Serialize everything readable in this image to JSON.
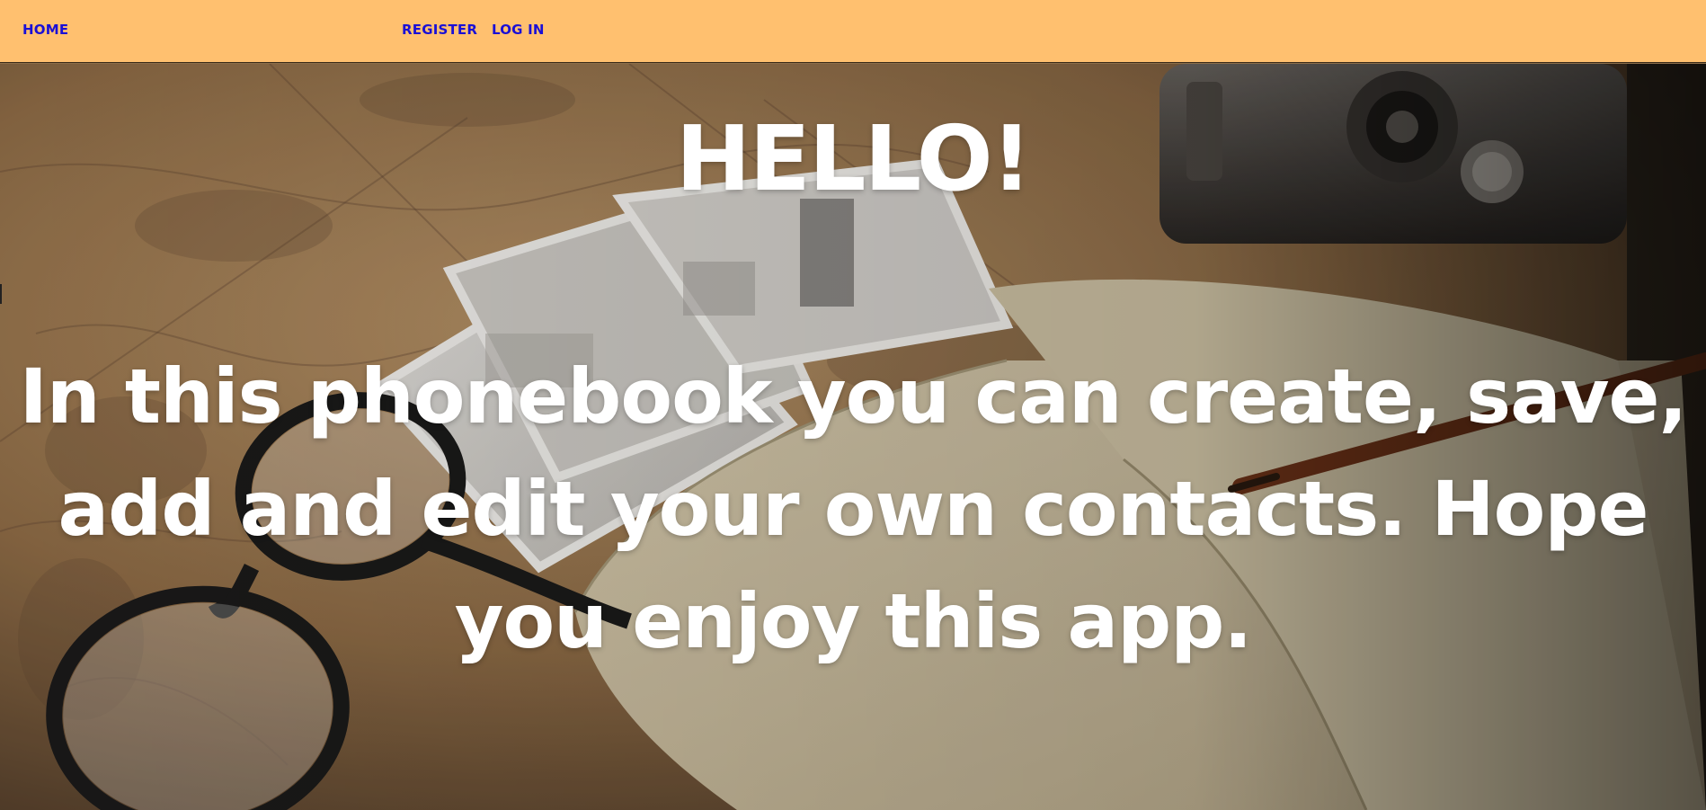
{
  "nav": {
    "home": "HOME",
    "register": "REGISTER",
    "login": "LOG IN"
  },
  "hero": {
    "title": "HELLO!",
    "text": "In this phonebook you can create, save, add and edit your own contacts. Hope you enjoy this app."
  },
  "colors": {
    "navbar_bg": "#ffc06f",
    "nav_link": "#1a0fd6",
    "hero_text": "#ffffff"
  },
  "background_image": "vintage-map-photos-glasses-notebook-camera"
}
